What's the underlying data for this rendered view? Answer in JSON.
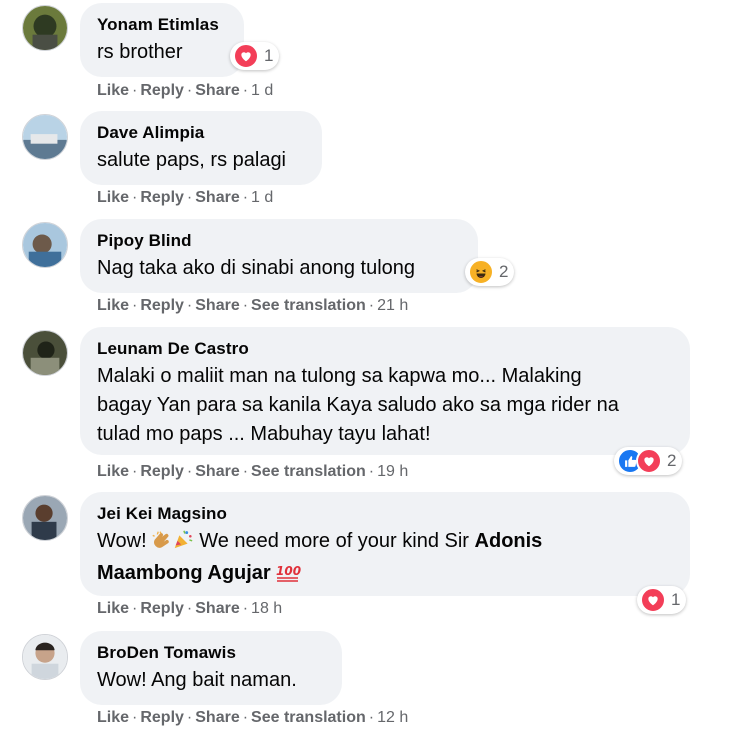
{
  "actions": {
    "like": "Like",
    "reply": "Reply",
    "share": "Share",
    "see_translation": "See translation",
    "sep": "·"
  },
  "comments": [
    {
      "author": "Yonam Etimlas",
      "text": "rs brother",
      "time": "1 d",
      "reactions": [
        "heart"
      ],
      "reaction_count": "1"
    },
    {
      "author": "Dave Alimpia",
      "text": "salute paps, rs palagi",
      "time": "1 d"
    },
    {
      "author": "Pipoy Blind",
      "text": "Nag taka ako di sinabi anong tulong",
      "time": "21 h",
      "reactions": [
        "haha"
      ],
      "reaction_count": "2",
      "has_translation": true
    },
    {
      "author": "Leunam De Castro",
      "text_lines": [
        "Malaki o maliit man na tulong sa kapwa mo... Malaking",
        "bagay Yan para sa kanila Kaya saludo ako sa mga rider na",
        "tulad mo paps ... Mabuhay tayu lahat!"
      ],
      "time": "19 h",
      "reactions": [
        "like",
        "heart"
      ],
      "reaction_count": "2",
      "has_translation": true
    },
    {
      "author": "Jei Kei Magsino",
      "text_prefix": "Wow!",
      "text_middle": "We need more of your kind Sir",
      "mention_line1": "Adonis",
      "mention_line2": "Maambong Agujar",
      "inline_emoji": [
        "clapping-hands",
        "party-popper",
        "hundred-points"
      ],
      "time": "18 h",
      "reactions": [
        "heart"
      ],
      "reaction_count": "1"
    },
    {
      "author": "BroDen Tomawis",
      "text": "Wow! Ang bait naman.",
      "time": "12 h",
      "has_translation": true
    }
  ],
  "colors": {
    "bubble": "#f0f2f5",
    "meta": "#65676b",
    "heart": "#f33e58",
    "like": "#1877f2",
    "haha": "#f7b125"
  }
}
